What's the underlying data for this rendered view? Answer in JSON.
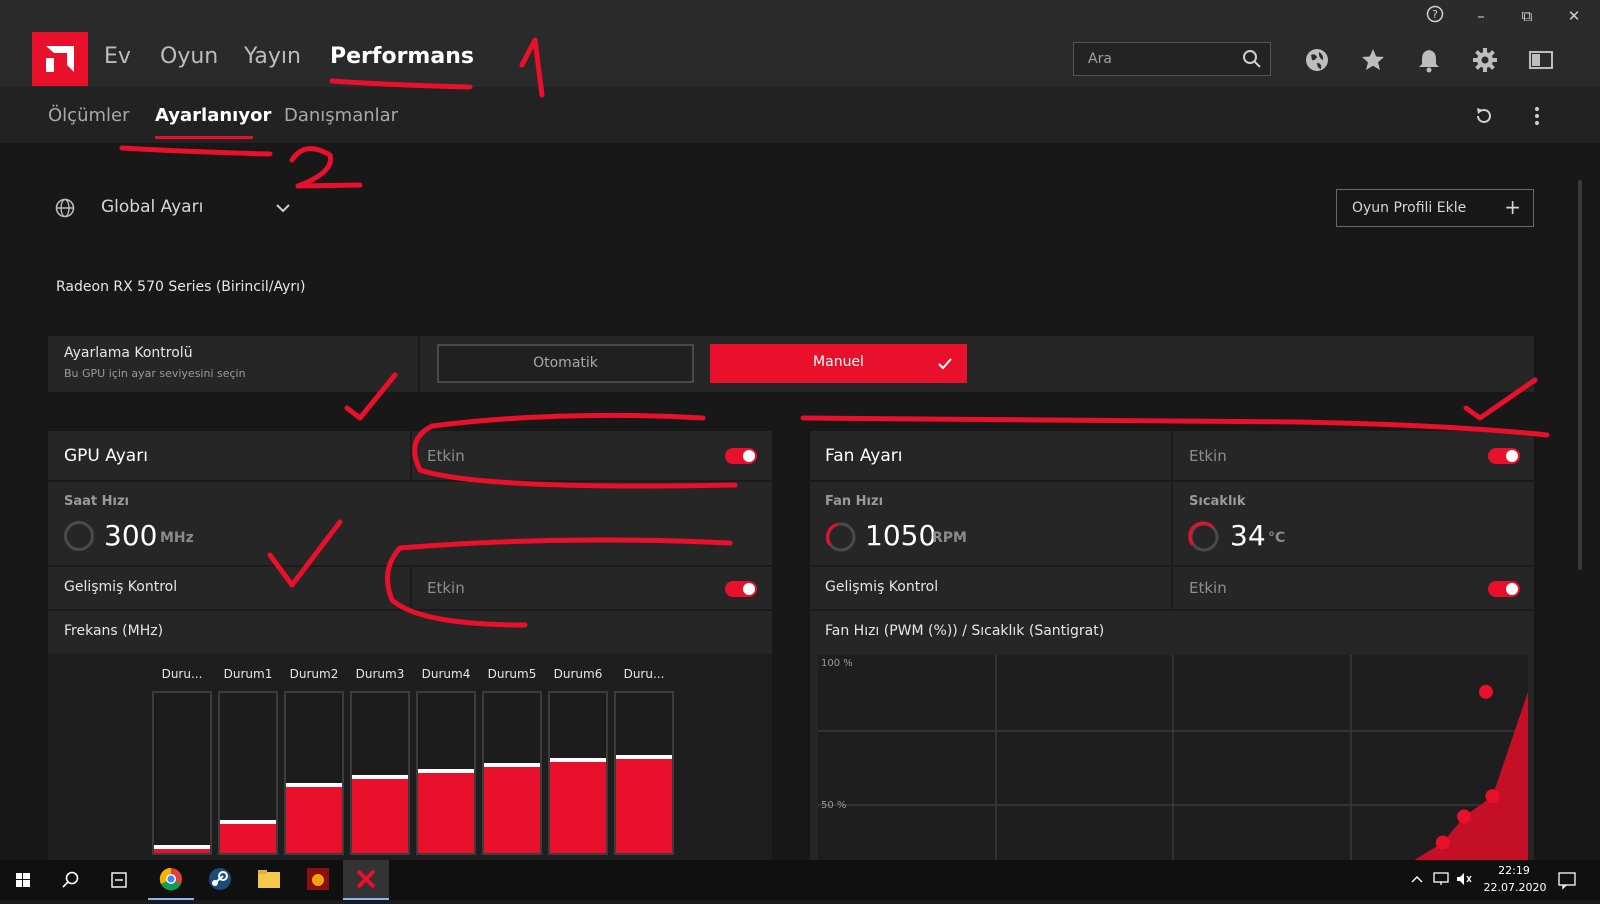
{
  "titlebar": {
    "help": "?",
    "minimize": "–",
    "restore": "⧉",
    "close": "✕"
  },
  "nav": {
    "tabs": [
      "Ev",
      "Oyun",
      "Yayın",
      "Performans"
    ],
    "active_tab": "Performans",
    "search_placeholder": "Ara"
  },
  "subnav": {
    "tabs": [
      "Ölçümler",
      "Ayarlanıyor",
      "Danışmanlar"
    ],
    "active_tab": "Ayarlanıyor"
  },
  "profile": {
    "selector_label": "Global Ayarı",
    "add_button": "Oyun Profili Ekle",
    "add_icon": "+"
  },
  "gpu_name": "Radeon RX 570 Series (Birincil/Ayrı)",
  "tuning_control": {
    "title": "Ayarlama Kontrolü",
    "subtitle": "Bu GPU için ayar seviyesini seçin",
    "auto_label": "Otomatik",
    "manual_label": "Manuel",
    "selected": "Manuel"
  },
  "gpu_panel": {
    "title": "GPU Ayarı",
    "enabled_label": "Etkin",
    "enabled": true,
    "clock_label": "Saat Hızı",
    "clock_value": "300",
    "clock_unit": "MHz",
    "advanced_label": "Gelişmiş Kontrol",
    "advanced_enabled_label": "Etkin",
    "advanced_enabled": true,
    "freq_title": "Frekans (MHz)",
    "states": [
      "Duru...",
      "Durum1",
      "Durum2",
      "Durum3",
      "Durum4",
      "Durum5",
      "Durum6",
      "Duru..."
    ],
    "state_levels": [
      0.01,
      0.18,
      0.41,
      0.46,
      0.5,
      0.54,
      0.57,
      0.59
    ]
  },
  "fan_panel": {
    "title": "Fan Ayarı",
    "enabled_label": "Etkin",
    "enabled": true,
    "fan_speed_label": "Fan Hızı",
    "fan_speed_value": "1050",
    "fan_speed_unit": "RPM",
    "temp_label": "Sıcaklık",
    "temp_value": "34",
    "temp_unit": "°C",
    "advanced_label": "Gelişmiş Kontrol",
    "advanced_enabled_label": "Etkin",
    "advanced_enabled": true,
    "curve_title": "Fan Hızı (PWM (%)) / Sıcaklık (Santigrat)",
    "y_tick_100": "100 %",
    "y_tick_50": "50 %"
  },
  "chart_data": {
    "type": "area",
    "title": "Fan Hızı (PWM (%)) / Sıcaklık (Santigrat)",
    "ylim": [
      0,
      100
    ],
    "y_ticks": [
      "100 %",
      "50 %"
    ],
    "points": [
      [
        0.57,
        0
      ],
      [
        0.84,
        0
      ],
      [
        0.88,
        6
      ],
      [
        0.91,
        15
      ],
      [
        0.95,
        22
      ],
      [
        1.0,
        58
      ]
    ]
  },
  "annotations": {
    "mark1": "1",
    "mark2": "2"
  },
  "taskbar": {
    "time": "22:19",
    "date": "22.07.2020"
  },
  "colors": {
    "accent": "#e8102b",
    "background": "#181818",
    "panel": "#262626"
  }
}
